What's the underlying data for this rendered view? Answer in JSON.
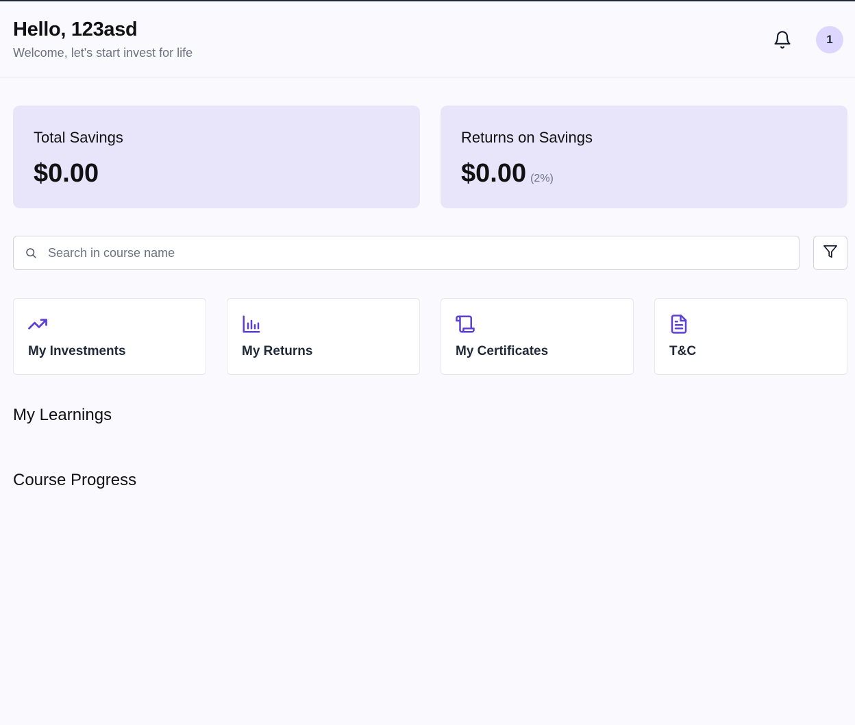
{
  "header": {
    "greeting": "Hello, 123asd",
    "subtitle": "Welcome, let's start invest for life",
    "avatar_text": "1"
  },
  "stats": {
    "total_savings": {
      "label": "Total Savings",
      "value": "$0.00"
    },
    "returns": {
      "label": "Returns on Savings",
      "value": "$0.00",
      "percent": "(2%)"
    }
  },
  "search": {
    "placeholder": "Search in course name",
    "value": ""
  },
  "quick_actions": [
    {
      "label": "My Investments",
      "icon": "trending-up-icon"
    },
    {
      "label": "My Returns",
      "icon": "bar-chart-icon"
    },
    {
      "label": "My Certificates",
      "icon": "scroll-icon"
    },
    {
      "label": "T&C",
      "icon": "document-icon"
    }
  ],
  "sections": {
    "learnings": "My Learnings",
    "progress": "Course Progress"
  },
  "colors": {
    "accent": "#5b3fd6",
    "stat_card_bg": "#e8e5fa",
    "avatar_bg": "#ddd6fe",
    "page_bg": "#fafafe"
  }
}
